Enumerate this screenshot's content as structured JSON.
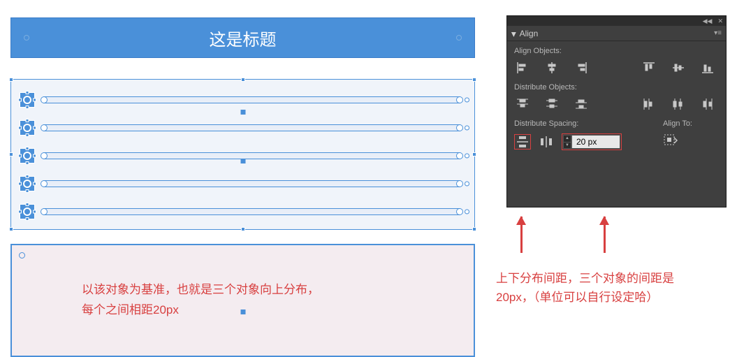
{
  "title": "这是标题",
  "annotation_left_l1": "以该对象为基准，也就是三个对象向上分布，",
  "annotation_left_l2": "每个之间相距20px",
  "panel": {
    "title": "Align",
    "section1": "Align Objects:",
    "section2": "Distribute Objects:",
    "section3": "Distribute Spacing:",
    "section4": "Align To:",
    "spacing_value": "20 px"
  },
  "annotation_right_l1": "上下分布间距，三个对象的间距是",
  "annotation_right_l2": "20px，（单位可以自行设定哈）"
}
